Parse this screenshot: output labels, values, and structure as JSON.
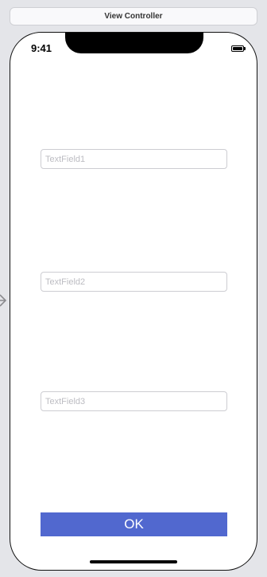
{
  "scene": {
    "title": "View Controller"
  },
  "status_bar": {
    "time": "9:41",
    "battery_icon": "battery-full-icon"
  },
  "fields": [
    {
      "placeholder": "TextField1",
      "value": ""
    },
    {
      "placeholder": "TextField2",
      "value": ""
    },
    {
      "placeholder": "TextField3",
      "value": ""
    }
  ],
  "ok_button": {
    "label": "OK"
  },
  "colors": {
    "canvas_background": "#e4e5e9",
    "button_background": "#5168cf",
    "button_text": "#ffffff",
    "placeholder_text": "#bcbcc2"
  }
}
